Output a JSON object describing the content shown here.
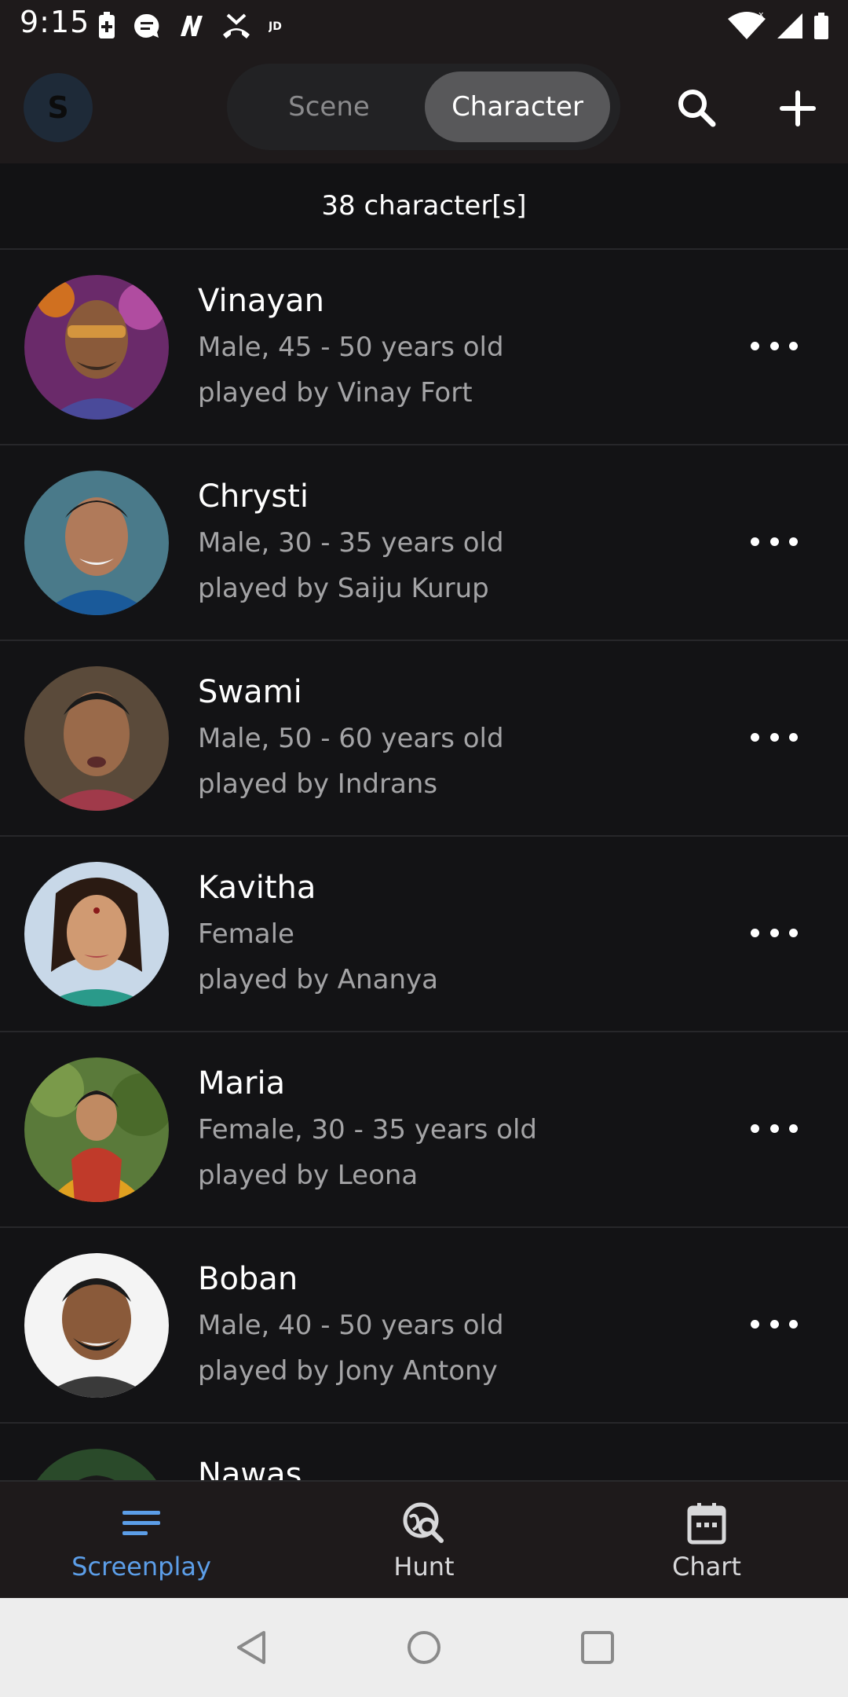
{
  "status_bar": {
    "time": "9:15",
    "left_icons": [
      "battery-saver-icon",
      "message-icon",
      "app-n-icon",
      "missed-call-icon",
      "jio-icon"
    ],
    "right_icons": [
      "wifi-icon",
      "cell-signal-icon",
      "battery-icon"
    ]
  },
  "top_bar": {
    "avatar_letter": "S",
    "tabs": [
      {
        "label": "Scene",
        "selected": false
      },
      {
        "label": "Character",
        "selected": true
      }
    ],
    "search_icon": "search-icon",
    "add_icon": "plus-icon"
  },
  "list_header": {
    "count_text": "38 character[s]"
  },
  "characters": [
    {
      "name": "Vinayan",
      "desc": "Male, 45 - 50 years old",
      "actor": "played by Vinay Fort"
    },
    {
      "name": "Chrysti",
      "desc": "Male, 30 - 35 years old",
      "actor": "played by Saiju Kurup"
    },
    {
      "name": "Swami",
      "desc": "Male, 50 - 60 years old",
      "actor": "played by Indrans"
    },
    {
      "name": "Kavitha",
      "desc": "Female",
      "actor": "played by Ananya"
    },
    {
      "name": "Maria",
      "desc": "Female, 30 - 35 years old",
      "actor": "played by Leona"
    },
    {
      "name": "Boban",
      "desc": "Male, 40 - 50 years old",
      "actor": "played by Jony Antony"
    },
    {
      "name": "Nawas",
      "desc": "",
      "actor": ""
    }
  ],
  "bottom_nav": {
    "items": [
      {
        "label": "Screenplay",
        "icon": "menu-lines-icon",
        "active": true
      },
      {
        "label": "Hunt",
        "icon": "search-globe-icon",
        "active": false
      },
      {
        "label": "Chart",
        "icon": "calendar-icon",
        "active": false
      }
    ]
  },
  "system_nav": {
    "icons": [
      "back-icon",
      "home-icon",
      "recents-icon"
    ]
  },
  "colors": {
    "accent": "#5c9ee8",
    "background": "#121214",
    "bar_background": "#1e1a1b",
    "secondary_text": "#a4a4a6"
  }
}
